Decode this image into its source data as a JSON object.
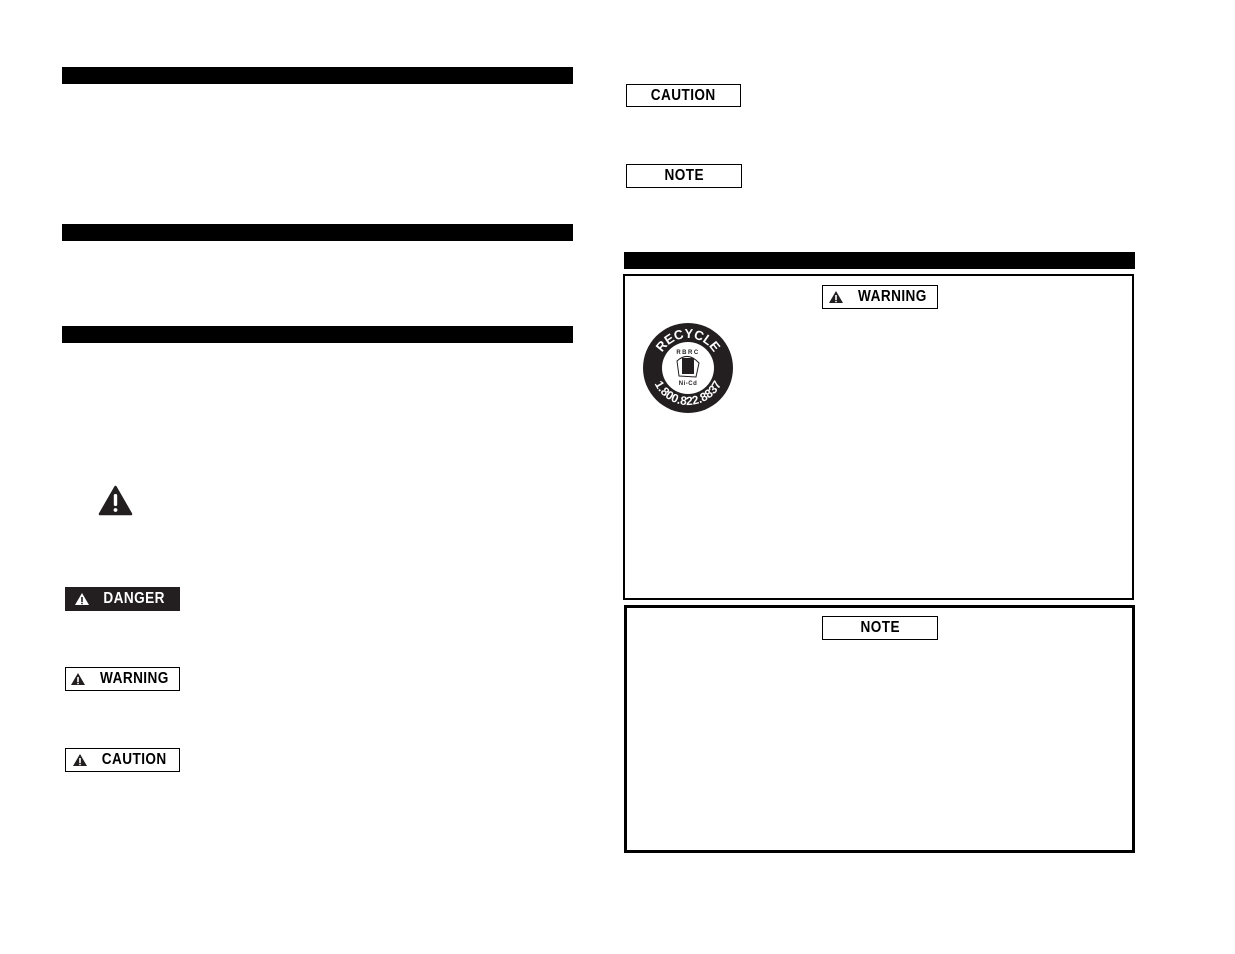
{
  "labels": {
    "danger": "DANGER",
    "warning": "WARNING",
    "caution": "CAUTION",
    "note": "NOTE"
  },
  "recycle_seal": {
    "top": "RECYCLE",
    "org": "RBRC",
    "chem": "Ni-Cd",
    "phone": "1.800.822.8837"
  },
  "icons": [
    "safety-alert-triangle-icon",
    "rbrc-recycle-seal"
  ]
}
